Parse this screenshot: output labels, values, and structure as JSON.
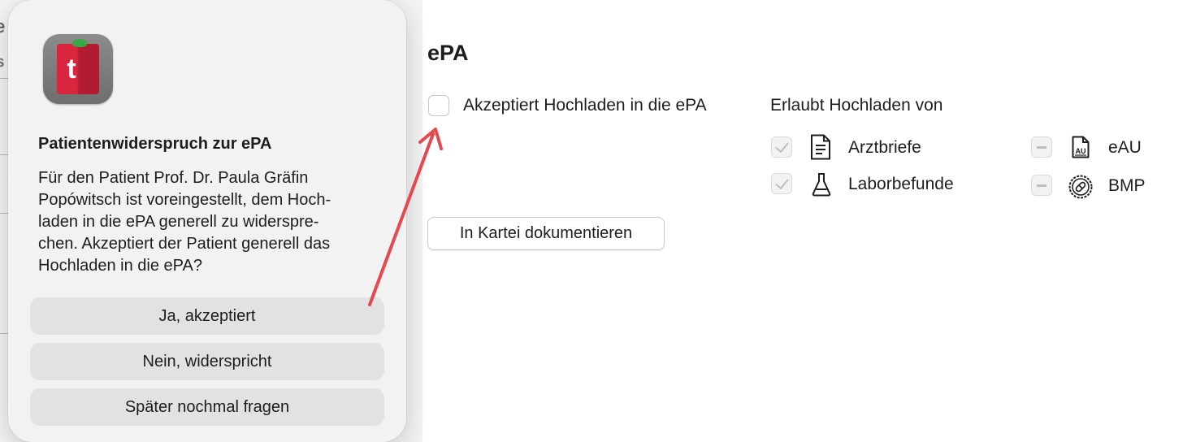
{
  "background_app": {
    "fragment_1": "e",
    "fragment_2": "s"
  },
  "dialog": {
    "title": "Patientenwiderspruch zur ePA",
    "message": "Für den Patient Prof. Dr. Paula Gräfin\nPopówitsch ist voreingestellt, dem Hoch-\nladen in die ePA generell zu widerspre-\nchen. Akzeptiert der Patient generell das\nHochladen in die ePA?",
    "buttons": [
      "Ja, akzeptiert",
      "Nein, widerspricht",
      "Später nochmal fragen"
    ],
    "icon": {
      "name": "app-icon",
      "letter": "t",
      "color": "#d7263d"
    }
  },
  "epa": {
    "title": "ePA",
    "accept_upload_label": "Akzeptiert Hochladen in die ePA",
    "accept_upload_checked": false,
    "allowed_from_label": "Erlaubt Hochladen von",
    "items": [
      {
        "label": "Arztbriefe",
        "state": "checked-disabled",
        "icon": "document-icon"
      },
      {
        "label": "Laborbefunde",
        "state": "checked-disabled",
        "icon": "flask-icon"
      },
      {
        "label": "eAU",
        "state": "mixed-disabled",
        "icon": "au-document-icon"
      },
      {
        "label": "BMP",
        "state": "mixed-disabled",
        "icon": "pill-badge-icon"
      }
    ],
    "document_button": "In Kartei dokumentieren"
  },
  "annotation": {
    "arrow_color": "#e5484d"
  }
}
